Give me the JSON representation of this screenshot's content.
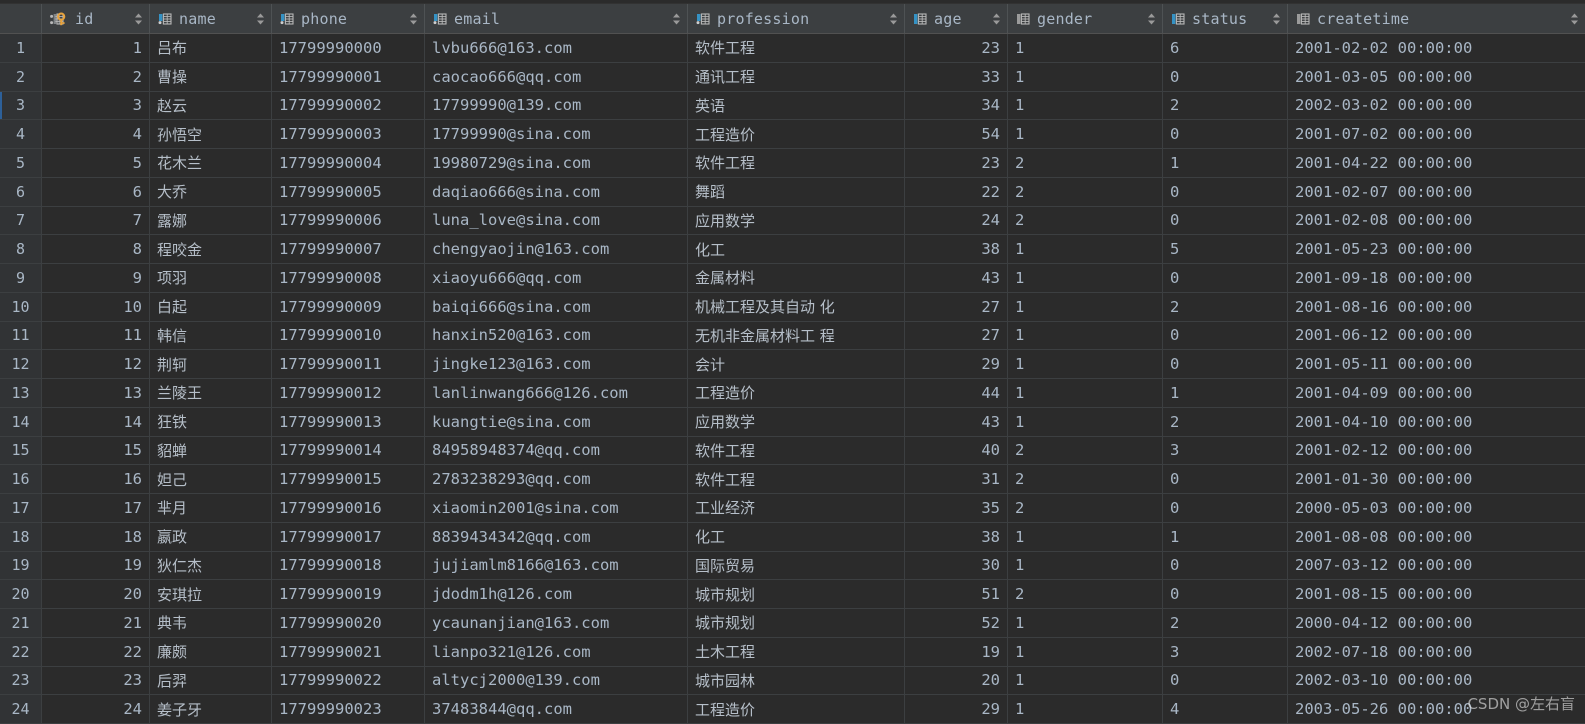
{
  "table": {
    "row_number_header": "",
    "selected_row_index": 3,
    "columns": [
      {
        "key": "id",
        "label": "id",
        "icon": "primary-key-column-icon",
        "icon_color": "#e8a33d",
        "sortable": true,
        "align": "right"
      },
      {
        "key": "name",
        "label": "name",
        "icon": "string-column-icon",
        "icon_color": "#3592c4",
        "sortable": true,
        "align": "left"
      },
      {
        "key": "phone",
        "label": "phone",
        "icon": "string-column-icon",
        "icon_color": "#3592c4",
        "sortable": true,
        "align": "left"
      },
      {
        "key": "email",
        "label": "email",
        "icon": "string-column-icon",
        "icon_color": "#3592c4",
        "sortable": true,
        "align": "left"
      },
      {
        "key": "profession",
        "label": "profession",
        "icon": "string-column-icon",
        "icon_color": "#3592c4",
        "sortable": true,
        "align": "left"
      },
      {
        "key": "age",
        "label": "age",
        "icon": "number-column-icon",
        "icon_color": "#3592c4",
        "sortable": true,
        "align": "right"
      },
      {
        "key": "gender",
        "label": "gender",
        "icon": "other-column-icon",
        "icon_color": "#9b9b9b",
        "sortable": true,
        "align": "left"
      },
      {
        "key": "status",
        "label": "status",
        "icon": "number-column-icon",
        "icon_color": "#3592c4",
        "sortable": true,
        "align": "left"
      },
      {
        "key": "createtime",
        "label": "createtime",
        "icon": "datetime-column-icon",
        "icon_color": "#9b9b9b",
        "sortable": true,
        "align": "left"
      }
    ],
    "rows": [
      {
        "n": "1",
        "id": "1",
        "name": "吕布",
        "phone": "17799990000",
        "email": "lvbu666@163.com",
        "profession": "软件工程",
        "age": "23",
        "gender": "1",
        "status": "6",
        "createtime": "2001-02-02 00:00:00"
      },
      {
        "n": "2",
        "id": "2",
        "name": "曹操",
        "phone": "17799990001",
        "email": "caocao666@qq.com",
        "profession": "通讯工程",
        "age": "33",
        "gender": "1",
        "status": "0",
        "createtime": "2001-03-05 00:00:00"
      },
      {
        "n": "3",
        "id": "3",
        "name": "赵云",
        "phone": "17799990002",
        "email": "17799990@139.com",
        "profession": "英语",
        "age": "34",
        "gender": "1",
        "status": "2",
        "createtime": "2002-03-02 00:00:00"
      },
      {
        "n": "4",
        "id": "4",
        "name": "孙悟空",
        "phone": "17799990003",
        "email": "17799990@sina.com",
        "profession": "工程造价",
        "age": "54",
        "gender": "1",
        "status": "0",
        "createtime": "2001-07-02 00:00:00"
      },
      {
        "n": "5",
        "id": "5",
        "name": "花木兰",
        "phone": "17799990004",
        "email": "19980729@sina.com",
        "profession": "软件工程",
        "age": "23",
        "gender": "2",
        "status": "1",
        "createtime": "2001-04-22 00:00:00"
      },
      {
        "n": "6",
        "id": "6",
        "name": "大乔",
        "phone": "17799990005",
        "email": "daqiao666@sina.com",
        "profession": "舞蹈",
        "age": "22",
        "gender": "2",
        "status": "0",
        "createtime": "2001-02-07 00:00:00"
      },
      {
        "n": "7",
        "id": "7",
        "name": "露娜",
        "phone": "17799990006",
        "email": "luna_love@sina.com",
        "profession": "应用数学",
        "age": "24",
        "gender": "2",
        "status": "0",
        "createtime": "2001-02-08 00:00:00"
      },
      {
        "n": "8",
        "id": "8",
        "name": "程咬金",
        "phone": "17799990007",
        "email": "chengyaojin@163.com",
        "profession": "化工",
        "age": "38",
        "gender": "1",
        "status": "5",
        "createtime": "2001-05-23 00:00:00"
      },
      {
        "n": "9",
        "id": "9",
        "name": "项羽",
        "phone": "17799990008",
        "email": "xiaoyu666@qq.com",
        "profession": "金属材料",
        "age": "43",
        "gender": "1",
        "status": "0",
        "createtime": "2001-09-18 00:00:00"
      },
      {
        "n": "10",
        "id": "10",
        "name": "白起",
        "phone": "17799990009",
        "email": "baiqi666@sina.com",
        "profession": "机械工程及其自动 化",
        "age": "27",
        "gender": "1",
        "status": "2",
        "createtime": "2001-08-16 00:00:00"
      },
      {
        "n": "11",
        "id": "11",
        "name": "韩信",
        "phone": "17799990010",
        "email": "hanxin520@163.com",
        "profession": "无机非金属材料工 程",
        "age": "27",
        "gender": "1",
        "status": "0",
        "createtime": "2001-06-12 00:00:00"
      },
      {
        "n": "12",
        "id": "12",
        "name": "荆轲",
        "phone": "17799990011",
        "email": "jingke123@163.com",
        "profession": "会计",
        "age": "29",
        "gender": "1",
        "status": "0",
        "createtime": "2001-05-11 00:00:00"
      },
      {
        "n": "13",
        "id": "13",
        "name": "兰陵王",
        "phone": "17799990012",
        "email": "lanlinwang666@126.com",
        "profession": "工程造价",
        "age": "44",
        "gender": "1",
        "status": "1",
        "createtime": "2001-04-09 00:00:00"
      },
      {
        "n": "14",
        "id": "14",
        "name": "狂铁",
        "phone": "17799990013",
        "email": "kuangtie@sina.com",
        "profession": "应用数学",
        "age": "43",
        "gender": "1",
        "status": "2",
        "createtime": "2001-04-10 00:00:00"
      },
      {
        "n": "15",
        "id": "15",
        "name": "貂蝉",
        "phone": "17799990014",
        "email": "84958948374@qq.com",
        "profession": "软件工程",
        "age": "40",
        "gender": "2",
        "status": "3",
        "createtime": "2001-02-12 00:00:00"
      },
      {
        "n": "16",
        "id": "16",
        "name": "妲己",
        "phone": "17799990015",
        "email": "2783238293@qq.com",
        "profession": "软件工程",
        "age": "31",
        "gender": "2",
        "status": "0",
        "createtime": "2001-01-30 00:00:00"
      },
      {
        "n": "17",
        "id": "17",
        "name": "芈月",
        "phone": "17799990016",
        "email": "xiaomin2001@sina.com",
        "profession": "工业经济",
        "age": "35",
        "gender": "2",
        "status": "0",
        "createtime": "2000-05-03 00:00:00"
      },
      {
        "n": "18",
        "id": "18",
        "name": "嬴政",
        "phone": "17799990017",
        "email": "8839434342@qq.com",
        "profession": "化工",
        "age": "38",
        "gender": "1",
        "status": "1",
        "createtime": "2001-08-08 00:00:00"
      },
      {
        "n": "19",
        "id": "19",
        "name": "狄仁杰",
        "phone": "17799990018",
        "email": "jujiamlm8166@163.com",
        "profession": "国际贸易",
        "age": "30",
        "gender": "1",
        "status": "0",
        "createtime": "2007-03-12 00:00:00"
      },
      {
        "n": "20",
        "id": "20",
        "name": "安琪拉",
        "phone": "17799990019",
        "email": "jdodm1h@126.com",
        "profession": "城市规划",
        "age": "51",
        "gender": "2",
        "status": "0",
        "createtime": "2001-08-15 00:00:00"
      },
      {
        "n": "21",
        "id": "21",
        "name": "典韦",
        "phone": "17799990020",
        "email": "ycaunanjian@163.com",
        "profession": "城市规划",
        "age": "52",
        "gender": "1",
        "status": "2",
        "createtime": "2000-04-12 00:00:00"
      },
      {
        "n": "22",
        "id": "22",
        "name": "廉颇",
        "phone": "17799990021",
        "email": "lianpo321@126.com",
        "profession": "土木工程",
        "age": "19",
        "gender": "1",
        "status": "3",
        "createtime": "2002-07-18 00:00:00"
      },
      {
        "n": "23",
        "id": "23",
        "name": "后羿",
        "phone": "17799990022",
        "email": "altycj2000@139.com",
        "profession": "城市园林",
        "age": "20",
        "gender": "1",
        "status": "0",
        "createtime": "2002-03-10 00:00:00"
      },
      {
        "n": "24",
        "id": "24",
        "name": "姜子牙",
        "phone": "17799990023",
        "email": "37483844@qq.com",
        "profession": "工程造价",
        "age": "29",
        "gender": "1",
        "status": "4",
        "createtime": "2003-05-26 00:00:00"
      }
    ]
  },
  "watermark": {
    "text": "CSDN @左右盲"
  },
  "colors": {
    "background": "#2b2b2b",
    "header_background": "#3c3f41",
    "row_number_background": "#313335",
    "grid_line": "#3c3f41",
    "text": "#a9b7c6",
    "number_text": "#6897bb",
    "selection_accent": "#2d6099",
    "icon_blue": "#3592c4",
    "icon_gray": "#9b9b9b",
    "icon_key_gold": "#e8a33d"
  }
}
